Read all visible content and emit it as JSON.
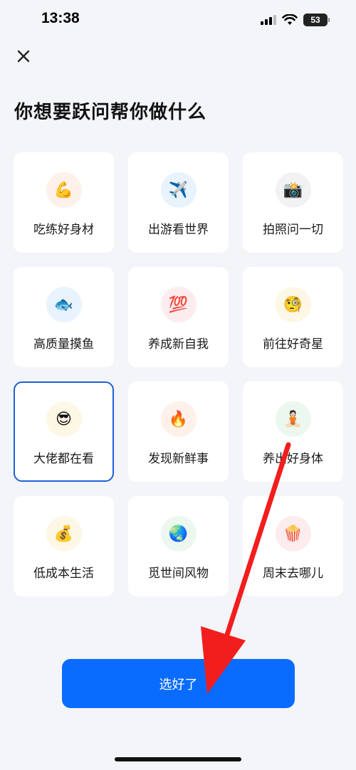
{
  "status_bar": {
    "time": "13:38",
    "battery": "53"
  },
  "header": {
    "title": "你想要跃问帮你做什么"
  },
  "options": [
    {
      "label": "吃练好身材",
      "emoji": "💪",
      "icon": "flexed-biceps-icon",
      "bg": "#fdf1ea"
    },
    {
      "label": "出游看世界",
      "emoji": "✈️",
      "icon": "airplane-icon",
      "bg": "#e9f3fd"
    },
    {
      "label": "拍照问一切",
      "emoji": "📸",
      "icon": "camera-flash-icon",
      "bg": "#f2f2f5"
    },
    {
      "label": "高质量摸鱼",
      "emoji": "🐟",
      "icon": "fish-icon",
      "bg": "#e9f3fd"
    },
    {
      "label": "养成新自我",
      "emoji": "💯",
      "icon": "hundred-points-icon",
      "bg": "#fdecee"
    },
    {
      "label": "前往好奇星",
      "emoji": "🧐",
      "icon": "monocle-face-icon",
      "bg": "#fdf8e6"
    },
    {
      "label": "大佬都在看",
      "emoji": "😎",
      "icon": "sunglasses-face-icon",
      "bg": "#fdf8e6",
      "selected": true
    },
    {
      "label": "发现新鲜事",
      "emoji": "🔥",
      "icon": "fire-icon",
      "bg": "#fdf1ea"
    },
    {
      "label": "养出好身体",
      "emoji": "🧘🏻",
      "icon": "meditation-icon",
      "bg": "#ecf8ef"
    },
    {
      "label": "低成本生活",
      "emoji": "💰",
      "icon": "money-bag-icon",
      "bg": "#fdf8e6"
    },
    {
      "label": "觅世间风物",
      "emoji": "🌏",
      "icon": "globe-icon",
      "bg": "#ecf8ef"
    },
    {
      "label": "周末去哪儿",
      "emoji": "🍿",
      "icon": "popcorn-icon",
      "bg": "#fdecee"
    }
  ],
  "footer": {
    "confirm_label": "选好了"
  },
  "colors": {
    "accent": "#0a6cff",
    "selected_border": "#1f5fd6",
    "annotation_arrow": "#f21d1d"
  }
}
